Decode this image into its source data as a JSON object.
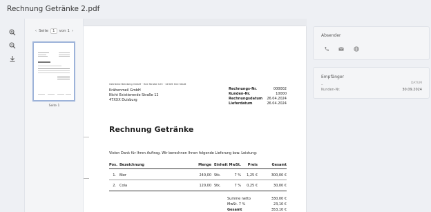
{
  "header": {
    "title": "Rechnung Getränke 2.pdf"
  },
  "toolbar": {
    "icons": [
      "zoom-in-icon",
      "zoom-out-icon",
      "download-icon"
    ]
  },
  "thumbnails": {
    "page_label": "Seite",
    "current_page": "1",
    "of_label": "von 1",
    "thumb_label": "Seite 1"
  },
  "document": {
    "sender_line": "Getränke Beinberg GmbH · Ihre Straße 123 · 12345 Ihre Stadt",
    "recipient": [
      "Krähenmeil GmbH",
      "Nicht Existierende Straße 12",
      "47XXX Duisburg"
    ],
    "meta": [
      {
        "label": "Rechnungs-Nr.",
        "value": "000002"
      },
      {
        "label": "Kunden-Nr.",
        "value": "10000"
      },
      {
        "label": "Rechnungsdatum",
        "value": "26.04.2024"
      },
      {
        "label": "Lieferdatum",
        "value": "26.04.2024"
      }
    ],
    "heading": "Rechnung Getränke",
    "intro": "Vielen Dank für Ihren Auftrag. Wir berechnen Ihnen folgende Lieferung bzw. Leistung:",
    "columns": {
      "pos": "Pos.",
      "desc": "Bezeichnung",
      "qty": "Menge",
      "unit": "Einheit",
      "vat": "MwSt.",
      "price": "Preis",
      "total": "Gesamt"
    },
    "rows": [
      {
        "pos": "1.",
        "desc": "Bier",
        "qty": "240,00",
        "unit": "Stk.",
        "vat": "7 %",
        "price": "1,25 €",
        "total": "300,00 €"
      },
      {
        "pos": "2.",
        "desc": "Cola",
        "qty": "120,00",
        "unit": "Stk.",
        "vat": "7 %",
        "price": "0,25 €",
        "total": "30,00 €"
      }
    ],
    "summary": [
      {
        "label": "Summe netto",
        "value": "330,00 €"
      },
      {
        "label": "MwSt. 7 %",
        "value": "23,10 €"
      },
      {
        "label": "Gesamt",
        "value": "353,10 €"
      }
    ]
  },
  "sender_card": {
    "title": "Absender",
    "icons": [
      "phone-icon",
      "email-icon",
      "web-icon"
    ]
  },
  "recipient_card": {
    "title": "Empfänger",
    "dash": "–",
    "date_label": "DATUM",
    "customer_label": "Kunden-Nr.",
    "date_value": "30.09.2024"
  }
}
